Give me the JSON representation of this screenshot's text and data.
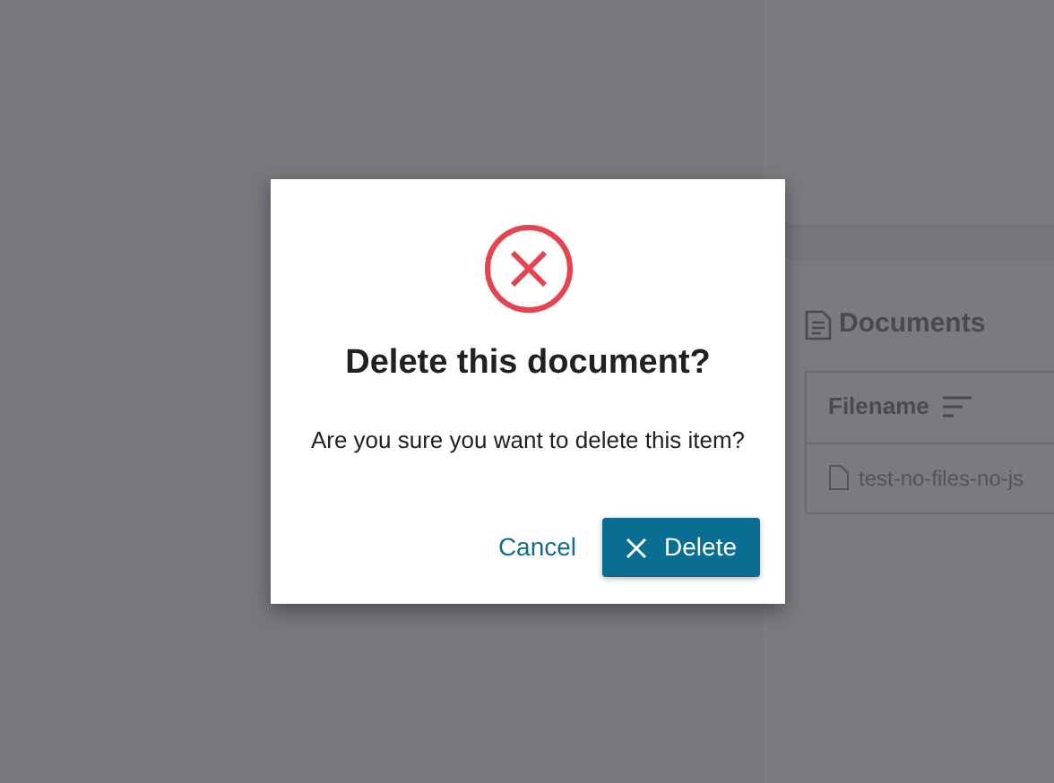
{
  "documents_panel": {
    "title": "Documents",
    "table": {
      "columns": [
        "Filename"
      ],
      "rows": [
        {
          "filename": "test-no-files-no-js"
        }
      ]
    }
  },
  "dialog": {
    "title": "Delete this document?",
    "message": "Are you sure you want to delete this item?",
    "buttons": [
      {
        "kind": "link",
        "label": "Cancel"
      },
      {
        "kind": "primary",
        "label": "Delete"
      }
    ]
  }
}
